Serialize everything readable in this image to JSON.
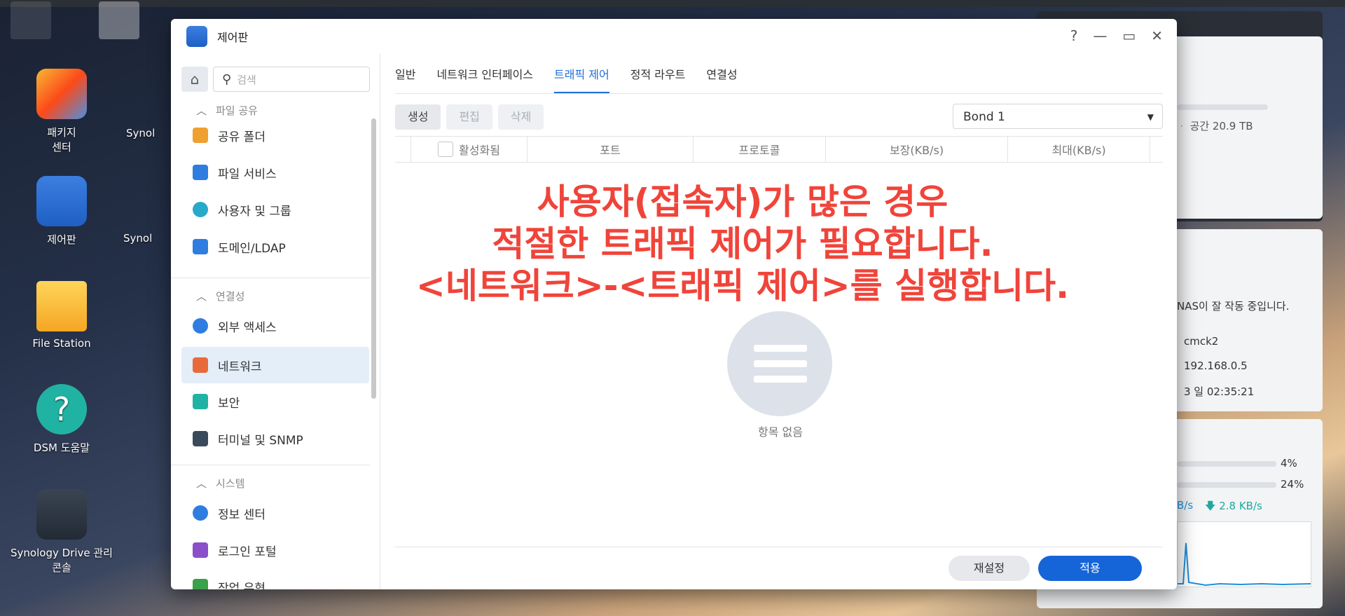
{
  "desktop": {
    "icons": [
      {
        "label_line1": "패키지",
        "label_line2": "센터",
        "icon": "package-center-icon"
      },
      {
        "label_line1": "제어판",
        "label_line2": "",
        "icon": "control-panel-icon"
      },
      {
        "label_line1": "File Station",
        "label_line2": "",
        "icon": "folder-icon"
      },
      {
        "label_line1": "DSM 도움말",
        "label_line2": "",
        "icon": "help-icon"
      },
      {
        "label_line1": "Synology Drive 관리",
        "label_line2": "콘솔",
        "icon": "synology-drive-icon"
      }
    ],
    "partial_labels": [
      "Synol",
      "Synol"
    ]
  },
  "widgets": {
    "storage_text": "ᆞ 공간 20.9 TB",
    "status_text": "NAS이 잘 작동 중입니다.",
    "hostname": "cmck2",
    "ip": "192.168.0.5",
    "uptime": "3 일 02:35:21",
    "cpu": "4%",
    "ram": "24%",
    "upload": "B/s",
    "download": "2.8 KB/s"
  },
  "window": {
    "title": "제어판",
    "controls": {
      "help": "?",
      "minimize": "—",
      "maximize": "▭",
      "close": "✕"
    }
  },
  "sidebar": {
    "search_placeholder": "검색",
    "sections": [
      {
        "label": "파일 공유"
      },
      {
        "label": "연결성"
      },
      {
        "label": "시스템"
      }
    ],
    "items": [
      {
        "label": "공유 폴더",
        "color": "#f0a030"
      },
      {
        "label": "파일 서비스",
        "color": "#2f7de1"
      },
      {
        "label": "사용자 및 그룹",
        "color": "#27a9c9"
      },
      {
        "label": "도메인/LDAP",
        "color": "#2f7de1"
      },
      {
        "label": "외부 액세스",
        "color": "#2f7de1"
      },
      {
        "label": "네트워크",
        "color": "#e86a3a"
      },
      {
        "label": "보안",
        "color": "#1fb3a3"
      },
      {
        "label": "터미널 및 SNMP",
        "color": "#3a4a5c"
      },
      {
        "label": "정보 센터",
        "color": "#2f7de1"
      },
      {
        "label": "로그인 포털",
        "color": "#8a4fc9"
      },
      {
        "label": "작업 유형",
        "color": "#3aa04a"
      }
    ]
  },
  "tabs": [
    "일반",
    "네트워크 인터페이스",
    "트래픽 제어",
    "정적 라우트",
    "연결성"
  ],
  "toolbar": {
    "create": "생성",
    "edit": "편집",
    "delete": "삭제",
    "interface": "Bond 1"
  },
  "table": {
    "columns": [
      "활성화됨",
      "포트",
      "프로토콜",
      "보장(KB/s)",
      "최대(KB/s)"
    ],
    "empty_text": "항목 없음"
  },
  "footer": {
    "reset": "재설정",
    "apply": "적용"
  },
  "overlay": {
    "line1": "사용자(접속자)가 많은 경우",
    "line2": "적절한 트래픽 제어가 필요합니다.",
    "line3": "<네트워크>-<트래픽 제어>를 실행합니다."
  }
}
